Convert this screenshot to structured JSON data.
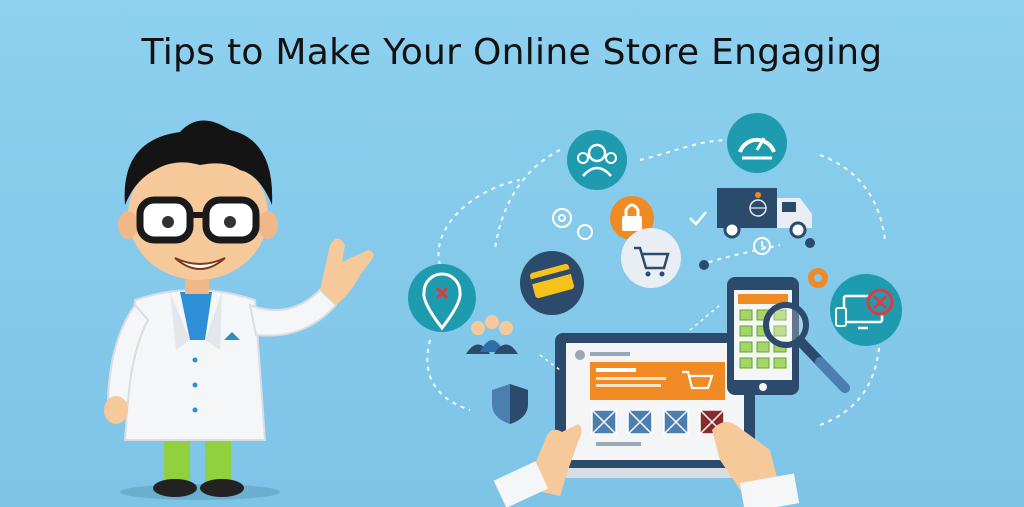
{
  "title": "Tips to Make Your Online Store Engaging",
  "colors": {
    "background": "#84c8ea",
    "teal_circle": "#1f9bb0",
    "orange": "#f08a24",
    "navy": "#2c4a6b",
    "coat": "#f4f6f8"
  },
  "icons": [
    "customers-icon",
    "speedometer-icon",
    "lock-icon",
    "cart-icon",
    "truck-icon",
    "credit-card-icon",
    "location-pin-icon",
    "team-icon",
    "shield-icon",
    "devices-icon",
    "gear-icon",
    "magnifier-icon",
    "smartphone-icon",
    "laptop-icon"
  ]
}
